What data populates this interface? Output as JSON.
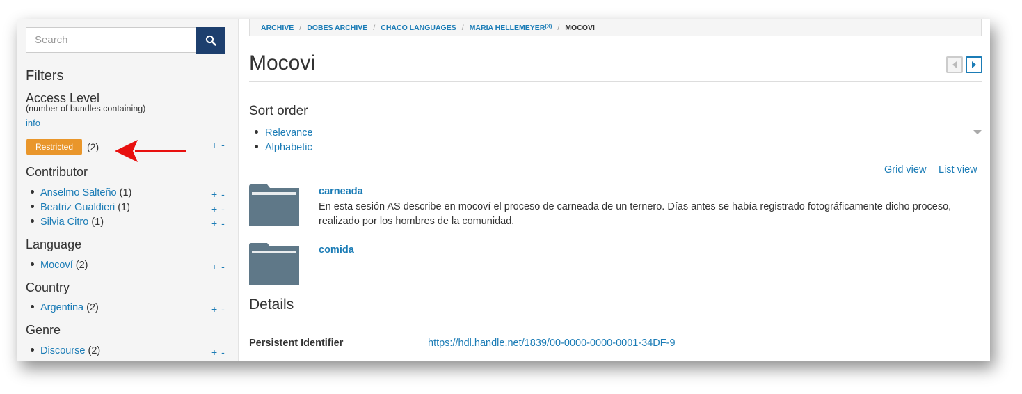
{
  "search": {
    "placeholder": "Search"
  },
  "sidebar": {
    "filters_heading": "Filters",
    "access_level": {
      "heading": "Access Level",
      "subtitle": "(number of bundles containing)",
      "info_link": "info",
      "badge_label": "Restricted",
      "badge_count": "(2)",
      "badge_color": "#e9962b"
    },
    "contributor": {
      "heading": "Contributor",
      "items": [
        {
          "label": "Anselmo Salteño",
          "count": "(1)"
        },
        {
          "label": "Beatriz Gualdieri",
          "count": "(1)"
        },
        {
          "label": "Silvia Citro",
          "count": "(1)"
        }
      ]
    },
    "language": {
      "heading": "Language",
      "items": [
        {
          "label": "Mocoví",
          "count": "(2)"
        }
      ]
    },
    "country": {
      "heading": "Country",
      "items": [
        {
          "label": "Argentina",
          "count": "(2)"
        }
      ]
    },
    "genre": {
      "heading": "Genre",
      "items": [
        {
          "label": "Discourse",
          "count": "(2)"
        }
      ]
    },
    "plus_label": "+",
    "minus_label": "-"
  },
  "breadcrumb": {
    "items": [
      "ARCHIVE",
      "DOBES ARCHIVE",
      "CHACO LANGUAGES",
      "MARIA HELLEMEYER"
    ],
    "remove_marker": "(X)",
    "separator": "/",
    "current": "MOCOVI"
  },
  "main": {
    "title": "Mocovi",
    "sort_heading": "Sort order",
    "sort_options": [
      "Relevance",
      "Alphabetic"
    ],
    "grid_view": "Grid view",
    "list_view": "List view",
    "items": [
      {
        "title": "carneada",
        "description": "En esta sesión AS describe en mocoví el proceso de carneada de un ternero. Días antes se había registrado fotográficamente dicho proceso, realizado por los hombres de la comunidad.",
        "icon": "folder-icon"
      },
      {
        "title": "comida",
        "description": "",
        "icon": "folder-icon"
      }
    ],
    "details_heading": "Details",
    "pid_label": "Persistent Identifier",
    "pid_value": "https://hdl.handle.net/1839/00-0000-0000-0001-34DF-9"
  },
  "colors": {
    "link": "#1b7cb6",
    "search_button": "#1d3f6e",
    "folder": "#5f7888",
    "annotation_arrow": "#e8100f"
  }
}
